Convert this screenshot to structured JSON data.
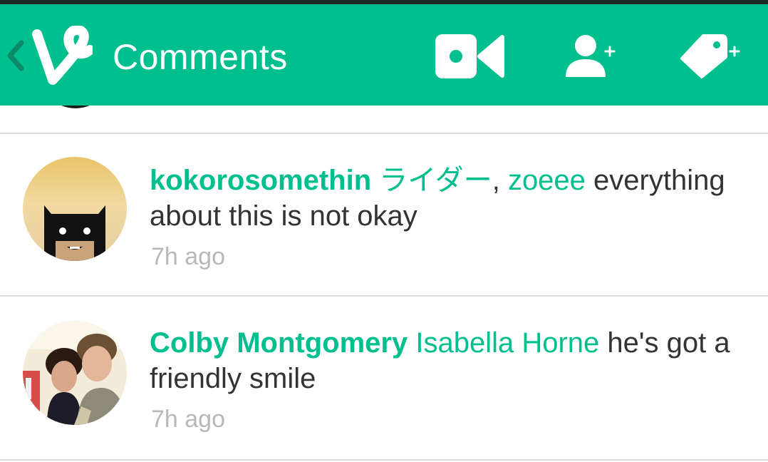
{
  "app_bar": {
    "title": "Comments",
    "color": "#00bf8f"
  },
  "icons": {
    "back": "chevron-left-icon",
    "logo": "vine-logo-icon",
    "camera": "video-camera-icon",
    "add_user": "add-user-icon",
    "add_tag": "add-tag-icon"
  },
  "comments": [
    {
      "author": "kokorosomethin",
      "mention_1": "ライダー",
      "separator": ",",
      "mention_2": "zoeee",
      "body": "everything about this is not okay",
      "time": "7h ago"
    },
    {
      "author": "Colby Montgomery",
      "mention_1": "Isabella Horne",
      "body": "he's got a friendly smile",
      "time": "7h ago"
    }
  ]
}
